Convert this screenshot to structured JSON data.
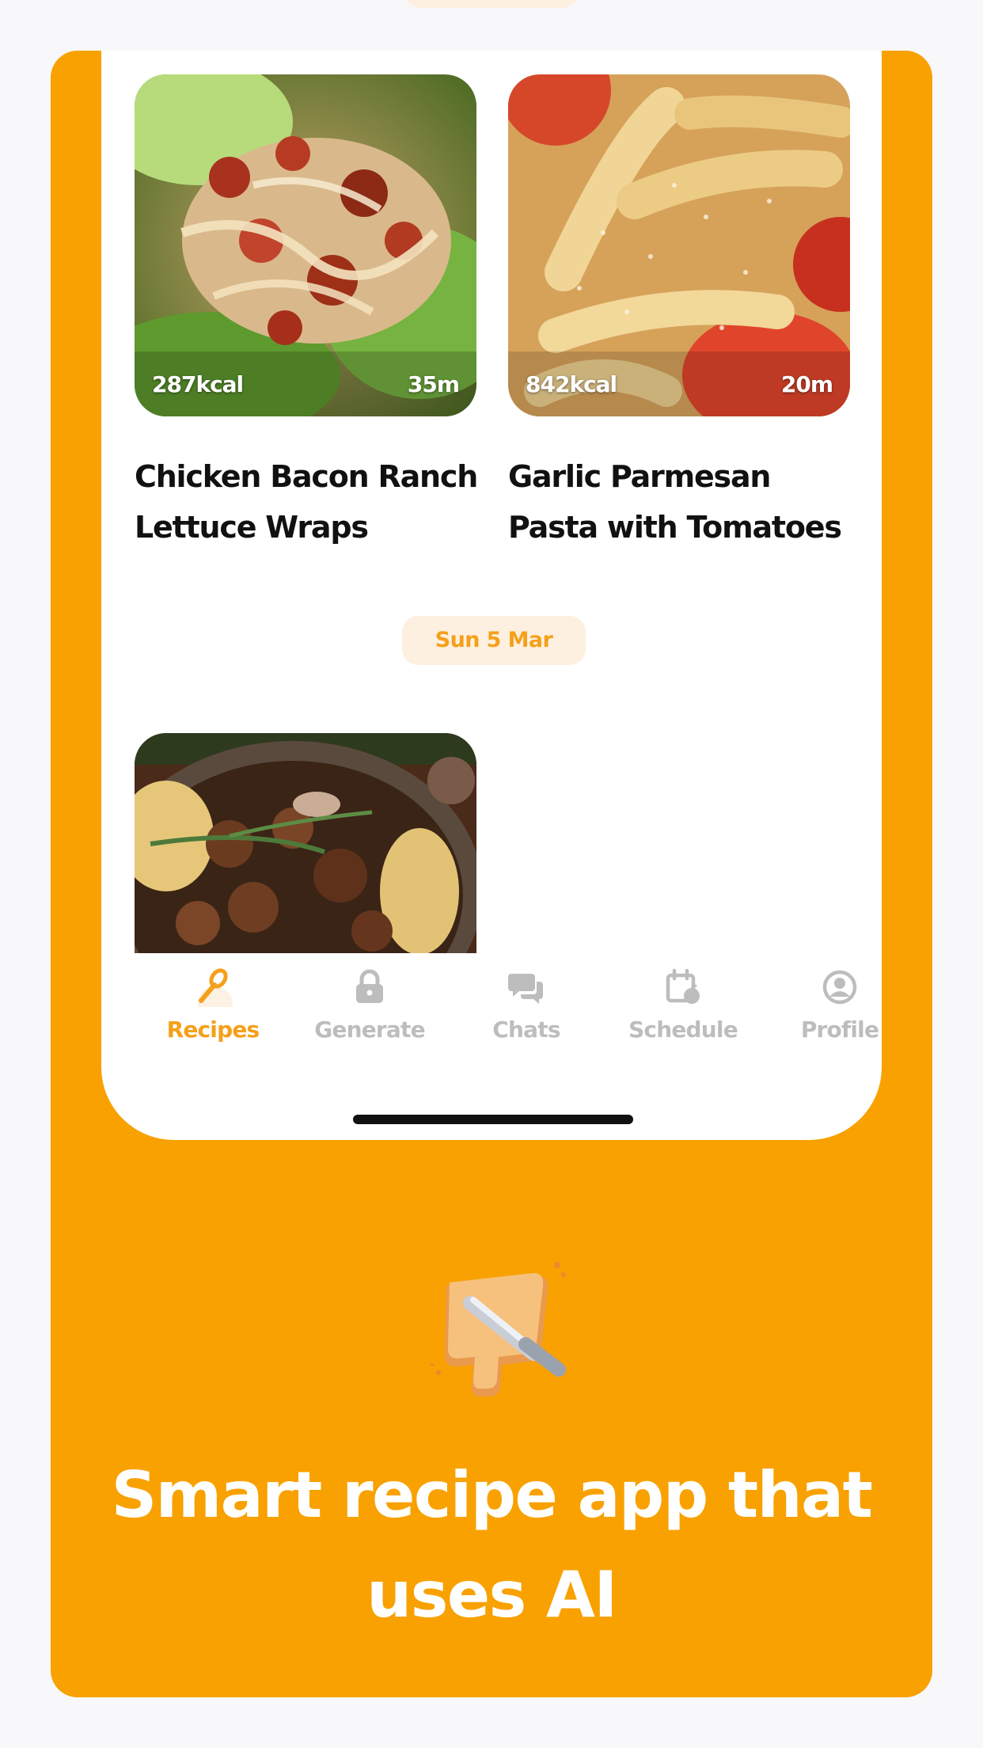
{
  "recipes": [
    {
      "title": "Chicken Bacon Ranch Lettuce Wraps",
      "calories": "287kcal",
      "time": "35m"
    },
    {
      "title": "Garlic Parmesan Pasta with Tomatoes",
      "calories": "842kcal",
      "time": "20m"
    }
  ],
  "date_label": "Sun 5 Mar",
  "tabs": [
    {
      "label": "Recipes",
      "icon": "whisk-icon",
      "active": true
    },
    {
      "label": "Generate",
      "icon": "lock-icon",
      "active": false
    },
    {
      "label": "Chats",
      "icon": "chat-bubbles-icon",
      "active": false
    },
    {
      "label": "Schedule",
      "icon": "calendar-icon",
      "active": false
    },
    {
      "label": "Profile",
      "icon": "profile-icon",
      "active": false
    }
  ],
  "headline": "Smart recipe app that uses AI",
  "colors": {
    "accent": "#F8A101",
    "active_tab": "#F5A01A",
    "inactive_tab": "#BDBDBD",
    "pill_bg": "#FDF0E0"
  }
}
